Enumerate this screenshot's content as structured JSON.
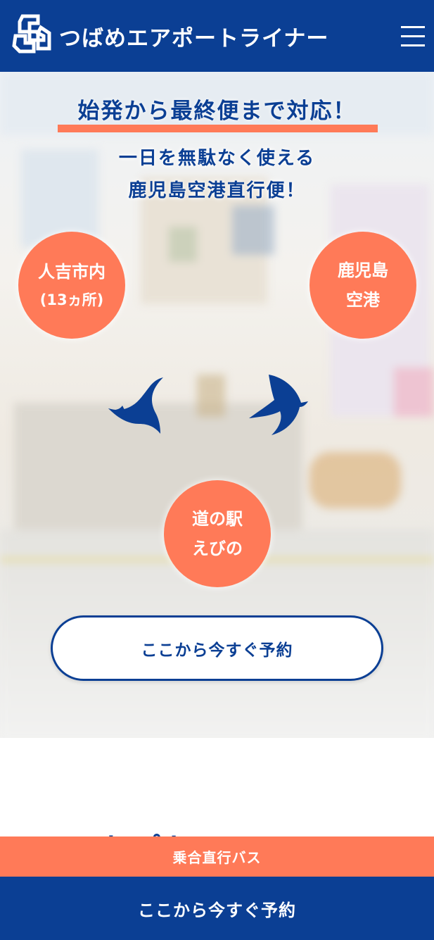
{
  "header": {
    "brand_name": "つばめエアポートライナー",
    "logo_icon": "stylized-interlocking-logo-icon",
    "menu_icon": "hamburger-menu-icon"
  },
  "hero": {
    "title": "始発から最終便まで対応！",
    "subtitle_line1": "一日を無駄なく使える",
    "subtitle_line2": "鹿児島空港直行便！",
    "stops": {
      "origin": {
        "line1": "人吉市内",
        "line2": "(13ヵ所)"
      },
      "airport": {
        "line1": "鹿児島",
        "line2": "空港"
      },
      "roadside": {
        "line1": "道の駅",
        "line2": "えびの"
      }
    },
    "bird_icon": "swallow-bird-icon",
    "reserve_label": "ここから今すぐ予約"
  },
  "next_section": {
    "heading_partial": "コンセプト"
  },
  "bottom_bar": {
    "tag_label": "乗合直行バス",
    "cta_label": "ここから今すぐ予約"
  },
  "colors": {
    "brand_blue": "#0b3f94",
    "accent_coral": "#ff7a58",
    "white": "#ffffff"
  }
}
